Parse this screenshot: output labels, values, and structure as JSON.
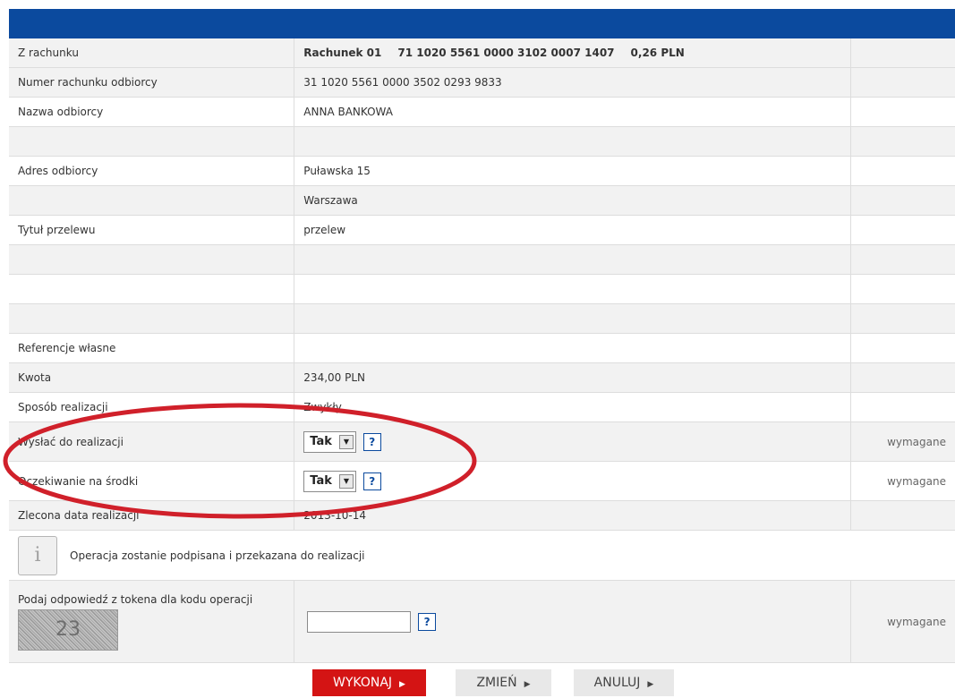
{
  "rows": {
    "from_account": {
      "label": "Z rachunku",
      "name": "Rachunek 01",
      "number": "71 1020 5561 0000 3102 0007 1407",
      "balance": "0,26 PLN"
    },
    "recipient_account": {
      "label": "Numer rachunku odbiorcy",
      "value": "31 1020 5561 0000 3502 0293 9833"
    },
    "recipient_name": {
      "label": "Nazwa odbiorcy",
      "value": "ANNA BANKOWA"
    },
    "recipient_address": {
      "label": "Adres odbiorcy",
      "line1": "Puławska 15",
      "line2": "Warszawa"
    },
    "transfer_title": {
      "label": "Tytuł przelewu",
      "value": "przelew"
    },
    "own_reference": {
      "label": "Referencje własne"
    },
    "amount": {
      "label": "Kwota",
      "value": "234,00 PLN"
    },
    "execution_method": {
      "label": "Sposób realizacji",
      "value": "Zwykły"
    },
    "send_for_execution": {
      "label": "Wysłać do realizacji",
      "value": "Tak",
      "help": "?",
      "required": "wymagane"
    },
    "wait_for_funds": {
      "label": "Oczekiwanie na środki",
      "value": "Tak",
      "help": "?",
      "required": "wymagane"
    },
    "execution_date": {
      "label": "Zlecona data realizacji",
      "value": "2013-10-14"
    },
    "info": {
      "icon": "info-icon",
      "text": "Operacja zostanie podpisana i przekazana do realizacji"
    },
    "token": {
      "label": "Podaj odpowiedź z tokena dla kodu operacji",
      "code": "23",
      "input_value": "",
      "help": "?",
      "required": "wymagane"
    }
  },
  "buttons": {
    "execute": "WYKONAJ",
    "change": "ZMIEŃ",
    "cancel": "ANULUJ"
  },
  "colors": {
    "header": "#0b4a9e",
    "primary_button": "#d41414",
    "annotation": "#d0202a"
  }
}
